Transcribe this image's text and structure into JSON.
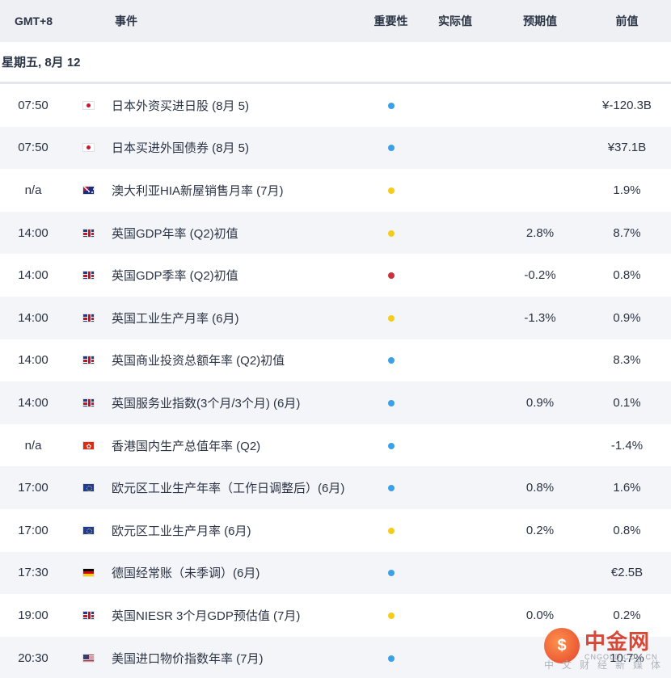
{
  "header": {
    "time": "GMT+8",
    "event": "事件",
    "importance": "重要性",
    "actual": "实际值",
    "forecast": "预期值",
    "previous": "前值"
  },
  "date_label": "星期五, 8月 12",
  "colors": {
    "blue": "#3aa0e8",
    "yellow": "#f5cc1b",
    "red": "#c8343c"
  },
  "rows": [
    {
      "time": "07:50",
      "flag": "flag-jp",
      "event": "日本外资买进日股 (8月 5)",
      "importance": "blue",
      "actual": "",
      "forecast": "",
      "previous": "¥-120.3B"
    },
    {
      "time": "07:50",
      "flag": "flag-jp",
      "event": "日本买进外国债券 (8月 5)",
      "importance": "blue",
      "actual": "",
      "forecast": "",
      "previous": "¥37.1B"
    },
    {
      "time": "n/a",
      "flag": "flag-au",
      "event": "澳大利亚HIA新屋销售月率 (7月)",
      "importance": "yellow",
      "actual": "",
      "forecast": "",
      "previous": "1.9%"
    },
    {
      "time": "14:00",
      "flag": "flag-gb",
      "event": "英国GDP年率 (Q2)初值",
      "importance": "yellow",
      "actual": "",
      "forecast": "2.8%",
      "previous": "8.7%"
    },
    {
      "time": "14:00",
      "flag": "flag-gb",
      "event": "英国GDP季率 (Q2)初值",
      "importance": "red",
      "actual": "",
      "forecast": "-0.2%",
      "previous": "0.8%"
    },
    {
      "time": "14:00",
      "flag": "flag-gb",
      "event": "英国工业生产月率 (6月)",
      "importance": "yellow",
      "actual": "",
      "forecast": "-1.3%",
      "previous": "0.9%"
    },
    {
      "time": "14:00",
      "flag": "flag-gb",
      "event": "英国商业投资总额年率 (Q2)初值",
      "importance": "blue",
      "actual": "",
      "forecast": "",
      "previous": "8.3%"
    },
    {
      "time": "14:00",
      "flag": "flag-gb",
      "event": "英国服务业指数(3个月/3个月) (6月)",
      "importance": "blue",
      "actual": "",
      "forecast": "0.9%",
      "previous": "0.1%"
    },
    {
      "time": "n/a",
      "flag": "flag-hk",
      "event": "香港国内生产总值年率 (Q2)",
      "importance": "blue",
      "actual": "",
      "forecast": "",
      "previous": "-1.4%"
    },
    {
      "time": "17:00",
      "flag": "flag-eu",
      "event": "欧元区工业生产年率（工作日调整后）(6月)",
      "importance": "blue",
      "actual": "",
      "forecast": "0.8%",
      "previous": "1.6%"
    },
    {
      "time": "17:00",
      "flag": "flag-eu",
      "event": "欧元区工业生产月率 (6月)",
      "importance": "yellow",
      "actual": "",
      "forecast": "0.2%",
      "previous": "0.8%"
    },
    {
      "time": "17:30",
      "flag": "flag-de",
      "event": "德国经常账（未季调）(6月)",
      "importance": "blue",
      "actual": "",
      "forecast": "",
      "previous": "€2.5B"
    },
    {
      "time": "19:00",
      "flag": "flag-gb",
      "event": "英国NIESR 3个月GDP预估值 (7月)",
      "importance": "yellow",
      "actual": "",
      "forecast": "0.0%",
      "previous": "0.2%"
    },
    {
      "time": "20:30",
      "flag": "flag-us",
      "event": "美国进口物价指数年率 (7月)",
      "importance": "blue",
      "actual": "",
      "forecast": "",
      "previous": "10.7%"
    }
  ],
  "watermark": {
    "cn": "中金网",
    "en": "CNGOLD.COM.CN",
    "sub": "中文财经新媒体"
  }
}
